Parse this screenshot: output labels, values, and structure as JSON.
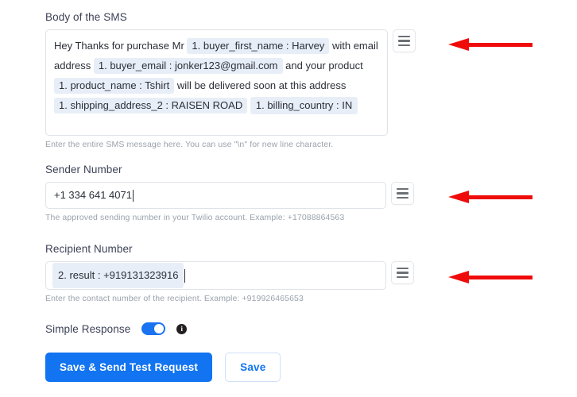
{
  "form": {
    "body_field": {
      "label": "Body of the SMS",
      "help": "Enter the entire SMS message here. You can use \"\\n\" for new line character.",
      "segments": [
        {
          "type": "text",
          "value": "Hey Thanks for purchase Mr"
        },
        {
          "type": "token",
          "value": "1. buyer_first_name : Harvey"
        },
        {
          "type": "text",
          "value": "with"
        },
        {
          "type": "text",
          "value": "email address"
        },
        {
          "type": "token",
          "value": "1. buyer_email : jonker123@gmail.com"
        },
        {
          "type": "text",
          "value": "and"
        },
        {
          "type": "text",
          "value": "your product"
        },
        {
          "type": "token",
          "value": "1. product_name : Tshirt"
        },
        {
          "type": "text",
          "value": "will be delivered soon at"
        },
        {
          "type": "text",
          "value": "this address"
        },
        {
          "type": "token",
          "value": "1. shipping_address_2 : RAISEN ROAD"
        },
        {
          "type": "token",
          "value": "1. billing_country : IN"
        }
      ],
      "line1_pre": "Hey Thanks for purchase Mr",
      "line1_token": "1. buyer_first_name : Harvey",
      "line1_post": "with",
      "line2_pre": "email address",
      "line2_token": "1. buyer_email : jonker123@gmail.com",
      "line2_post": "and",
      "line3_pre": "your product",
      "line3_token": "1. product_name : Tshirt",
      "line3_post": "will be delivered soon at",
      "line4_pre": "this address",
      "line4_token": "1. shipping_address_2 : RAISEN ROAD",
      "line5_token": "1. billing_country : IN",
      "handle_icon": "hamburger-icon"
    },
    "sender_field": {
      "label": "Sender Number",
      "value": "+1 334 641 4071",
      "help": "The approved sending number in your Twilio account. Example: +17088864563",
      "handle_icon": "hamburger-icon"
    },
    "recipient_field": {
      "label": "Recipient Number",
      "token": "2. result : +919131323916",
      "help": "Enter the contact number of the recipient. Example: +919926465653",
      "handle_icon": "hamburger-icon"
    },
    "simple_response": {
      "label": "Simple Response",
      "state": "on",
      "info_icon": "info-icon"
    },
    "actions": {
      "primary_label": "Save & Send Test Request",
      "secondary_label": "Save"
    }
  },
  "annotations": {
    "arrow_icon": "arrow-left-icon",
    "color": "#f00b0b",
    "count": 3
  },
  "colors": {
    "accent": "#1274f0",
    "token_bg": "#e8eef7",
    "label": "#3c4257",
    "help": "#9aa3ad",
    "border": "#dfe3e8",
    "arrow": "#f00b0b"
  }
}
